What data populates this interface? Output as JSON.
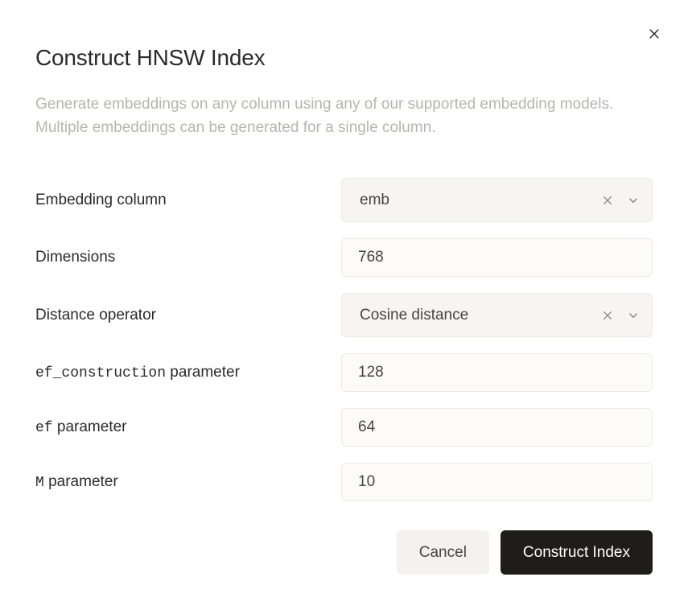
{
  "dialog": {
    "title": "Construct HNSW Index",
    "description": "Generate embeddings on any column using any of our supported embedding models. Multiple embeddings can be generated for a single column."
  },
  "fields": {
    "embedding_column": {
      "label": "Embedding column",
      "value": "emb"
    },
    "dimensions": {
      "label": "Dimensions",
      "value": "768"
    },
    "distance_operator": {
      "label": "Distance operator",
      "value": "Cosine distance"
    },
    "ef_construction": {
      "label_mono": "ef_construction",
      "label_rest": " parameter",
      "value": "128"
    },
    "ef": {
      "label_mono": "ef",
      "label_rest": " parameter",
      "value": "64"
    },
    "m": {
      "label_mono": "M",
      "label_rest": " parameter",
      "value": "10"
    }
  },
  "buttons": {
    "cancel": "Cancel",
    "submit": "Construct Index"
  }
}
